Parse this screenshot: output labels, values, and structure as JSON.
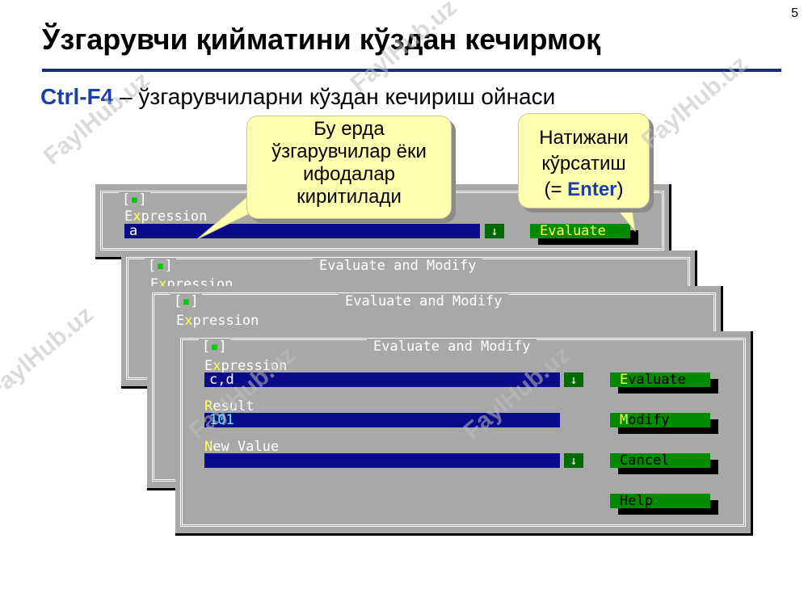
{
  "slide": {
    "number": "5",
    "title": "Ўзгарувчи қийматини кўздан кечирмоқ",
    "subtitle_key": "Ctrl-F4",
    "subtitle_rest": " – ўзгарувчиларни кўздан кечириш ойнаси"
  },
  "callouts": {
    "input_note": [
      "Бу ерда",
      "ўзгарувчилар ёки",
      "ифодалар",
      "киритилади"
    ],
    "evaluate_note_l1": "Натижани",
    "evaluate_note_l2": "кўрсатиш",
    "evaluate_note_l3_pre": "(= ",
    "evaluate_note_l3_key": "Enter",
    "evaluate_note_l3_post": ")"
  },
  "watermark": "FaylHub.uz",
  "dialog": {
    "title": "Evaluate and Modify",
    "close_box": "[▪]",
    "expression_hotkey": "x",
    "expression_pre": "E",
    "expression_post": "pression",
    "result_hotkey": "R",
    "result_post": "esult",
    "newvalue_hotkey": "N",
    "newvalue_post": "ew Value",
    "arrow": "↓",
    "buttons": {
      "evaluate_hk": "E",
      "evaluate_rest": "valuate",
      "evaluate_full": "Evaluate",
      "modify_hk": "M",
      "modify_rest": "odify",
      "cancel": "Cancel",
      "help": "Help"
    }
  },
  "dialogs": {
    "d1": {
      "expression": "a"
    },
    "d4": {
      "expression": "c,d",
      "result": "101",
      "new_value": ""
    }
  },
  "colors": {
    "title_rule": "#1c2c7a",
    "accent": "#1a3fa8",
    "dialog_bg": "#a8a8a8",
    "field_bg": "#0a0a8a",
    "button_bg": "#008a00",
    "hotkey": "#ffff55",
    "callout_bg": "#ffffb0"
  }
}
